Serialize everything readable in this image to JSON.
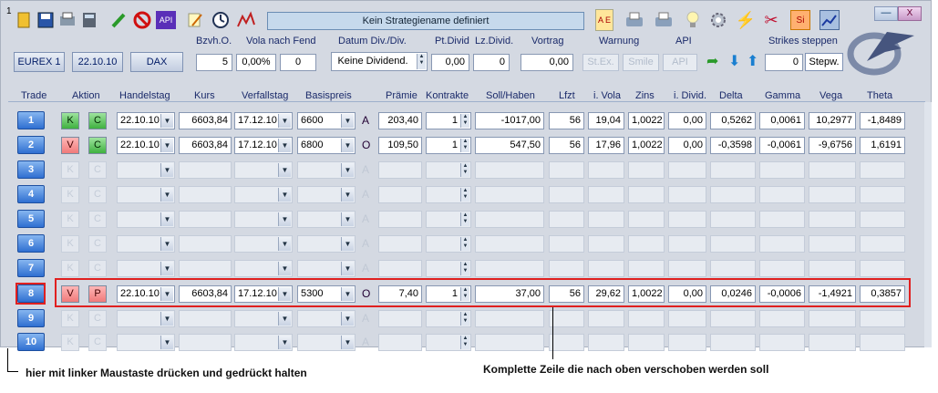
{
  "app": {
    "window_number": "1",
    "strategy_name": "Kein Strategiename definiert",
    "minimize_label": "—",
    "close_label": "X"
  },
  "toolbar": {
    "icons": [
      "folder-open-icon",
      "save-icon",
      "print-icon",
      "calculator-icon",
      "pencil-icon",
      "forbidden-icon",
      "api-icon",
      "note-edit-icon",
      "clock-icon",
      "chart-tool-icon",
      "logo-small-icon",
      "ae-icon",
      "printer-icon",
      "printer2-icon",
      "bulb-icon",
      "gear-icon",
      "lightning-icon",
      "scissors-icon",
      "si-icon",
      "chart-icon"
    ],
    "api_label": "API",
    "ae_label": "A E",
    "si_label": "Si"
  },
  "params": {
    "labels": {
      "bzvh": "Bzvh.O.",
      "vola_fend": "Vola nach Fend",
      "datum_div": "Datum Div./Div.",
      "pt_divid": "Pt.Divid",
      "lz_divid": "Lz.Divid.",
      "vortrag": "Vortrag",
      "warnung": "Warnung",
      "api": "API",
      "strikes": "Strikes steppen"
    },
    "exchange": "EUREX 1",
    "date": "22.10.10",
    "index": "DAX",
    "bzvh_value": "5",
    "vola_pct": "0,00%",
    "vola_value": "0",
    "dividend_select": "Keine Dividend.",
    "pt_divid_value": "0,00",
    "lz_divid_value": "0",
    "vortrag_value": "0,00",
    "warn_stex": "St.Ex.",
    "warn_smile": "Smile",
    "api_button": "API",
    "strikes_value": "0",
    "stepw_label": "Stepw."
  },
  "columns": [
    "Trade",
    "Aktion",
    "Handelstag",
    "Kurs",
    "Verfallstag",
    "Basispreis",
    "Prämie",
    "Kontrakte",
    "Soll/Haben",
    "Lfzt",
    "i. Vola",
    "Zins",
    "i. Divid.",
    "Delta",
    "Gamma",
    "Vega",
    "Theta"
  ],
  "rows": [
    {
      "trade": "1",
      "a1": "K",
      "a2": "C",
      "handelstag": "22.10.10",
      "kurs": "6603,84",
      "verfall": "17.12.10",
      "basis": "6600",
      "typ": "A",
      "praemie": "203,40",
      "kontrakte": "1",
      "soll": "-1017,00",
      "lfzt": "56",
      "vola": "19,04",
      "zins": "1,0022",
      "divid": "0,00",
      "delta": "0,5262",
      "gamma": "0,0061",
      "vega": "10,2977",
      "theta": "-1,8489"
    },
    {
      "trade": "2",
      "a1": "V",
      "a2": "C",
      "handelstag": "22.10.10",
      "kurs": "6603,84",
      "verfall": "17.12.10",
      "basis": "6800",
      "typ": "O",
      "praemie": "109,50",
      "kontrakte": "1",
      "soll": "547,50",
      "lfzt": "56",
      "vola": "17,96",
      "zins": "1,0022",
      "divid": "0,00",
      "delta": "-0,3598",
      "gamma": "-0,0061",
      "vega": "-9,6756",
      "theta": "1,6191"
    }
  ],
  "empty_rows": [
    {
      "trade": "3",
      "a1": "K",
      "a2": "C",
      "typ": "A"
    },
    {
      "trade": "4",
      "a1": "K",
      "a2": "C",
      "typ": "A"
    },
    {
      "trade": "5",
      "a1": "K",
      "a2": "C",
      "typ": "A"
    },
    {
      "trade": "6",
      "a1": "K",
      "a2": "C",
      "typ": "A"
    },
    {
      "trade": "7",
      "a1": "K",
      "a2": "C",
      "typ": "A"
    }
  ],
  "row8": {
    "trade": "8",
    "a1": "V",
    "a2": "P",
    "handelstag": "22.10.10",
    "kurs": "6603,84",
    "verfall": "17.12.10",
    "basis": "5300",
    "typ": "O",
    "praemie": "7,40",
    "kontrakte": "1",
    "soll": "37,00",
    "lfzt": "56",
    "vola": "29,62",
    "zins": "1,0022",
    "divid": "0,00",
    "delta": "0,0246",
    "gamma": "-0,0006",
    "vega": "-1,4921",
    "theta": "0,3857"
  },
  "row9": {
    "trade": "9",
    "a1": "K",
    "a2": "C",
    "typ": "A"
  },
  "row10": {
    "trade": "10",
    "a1": "K",
    "a2": "C",
    "typ": "A"
  },
  "annotations": {
    "left_note": "hier mit linker Maustaste drücken und gedrückt halten",
    "right_note": "Komplette Zeile die nach oben verschoben werden soll"
  },
  "colors": {
    "highlight": "#e02020",
    "trade_button": "#2f6fd1"
  }
}
